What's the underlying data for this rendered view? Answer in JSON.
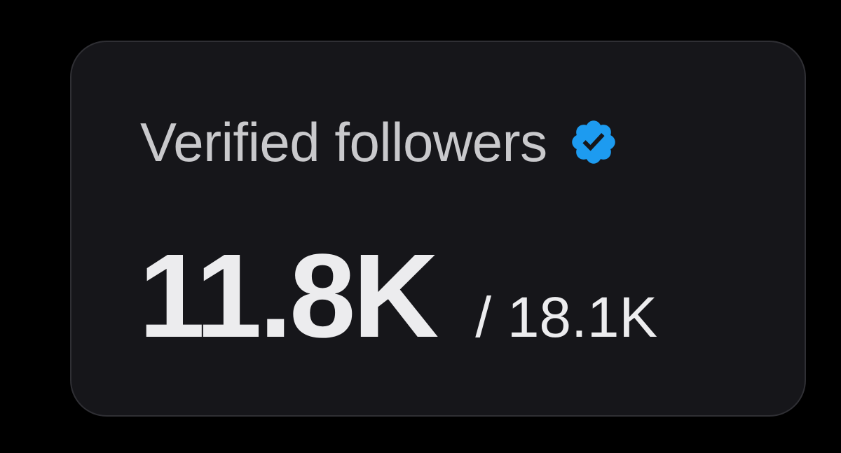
{
  "card": {
    "title": "Verified followers",
    "badge_icon": "verified-badge-icon",
    "badge_color": "#1d9bf0",
    "value": "11.8K",
    "total": "/ 18.1K"
  }
}
